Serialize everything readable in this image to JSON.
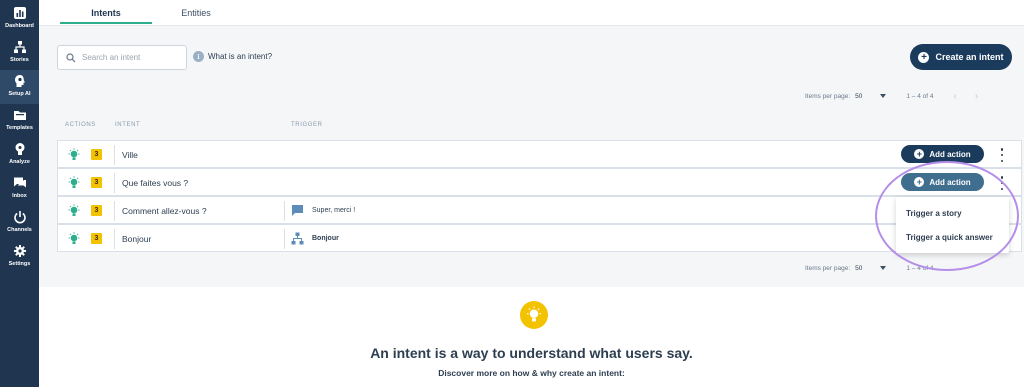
{
  "sidebar": {
    "items": [
      {
        "label": "Dashboard",
        "icon": "dashboard-icon"
      },
      {
        "label": "Stories",
        "icon": "stories-icon"
      },
      {
        "label": "Setup AI",
        "icon": "head-icon",
        "active": true
      },
      {
        "label": "Templates",
        "icon": "folder-icon"
      },
      {
        "label": "Analyze",
        "icon": "bulb-icon"
      },
      {
        "label": "Inbox",
        "icon": "chat-icon"
      },
      {
        "label": "Channels",
        "icon": "power-icon"
      },
      {
        "label": "Settings",
        "icon": "gear-icon"
      }
    ]
  },
  "tabs": [
    {
      "label": "Intents",
      "active": true
    },
    {
      "label": "Entities",
      "active": false
    }
  ],
  "toolbar": {
    "search_placeholder": "Search an intent",
    "info_icon_glyph": "i",
    "info_label": "What is an intent?",
    "create_label": "Create an intent"
  },
  "pagination_top": {
    "label": "Items per page:",
    "value": "50",
    "range": "1 – 4 of 4",
    "prev_glyph": "‹",
    "next_glyph": "›"
  },
  "pagination_bottom": {
    "label": "Items per page:",
    "value": "50",
    "range": "1 – 4 of 4"
  },
  "columns": {
    "actions": "ACTIONS",
    "intent": "INTENT",
    "trigger": "TRIGGER"
  },
  "rows": [
    {
      "badge": "3",
      "name": "Ville",
      "trigger_text": "",
      "trigger_icon": null
    },
    {
      "badge": "3",
      "name": "Que faites vous ?",
      "trigger_text": "",
      "trigger_icon": null
    },
    {
      "badge": "3",
      "name": "Comment allez-vous ?",
      "trigger_text": "Super, merci !",
      "trigger_icon": "chat-bubble-icon"
    },
    {
      "badge": "3",
      "name": "Bonjour",
      "trigger_text": "Bonjour",
      "trigger_icon": "sitemap-icon"
    }
  ],
  "add_action_label": "Add action",
  "dropdown": {
    "items": [
      "Trigger a story",
      "Trigger a quick answer"
    ]
  },
  "info_section": {
    "title": "An intent is a way to understand what users say.",
    "subtitle": "Discover more on how & why create an intent:"
  },
  "colors": {
    "sidebar_bg": "#1f3550",
    "primary": "#1b3b5c",
    "accent_green": "#2eae8c",
    "badge_yellow": "#f3c200",
    "highlight_purple": "#b48ee8"
  }
}
